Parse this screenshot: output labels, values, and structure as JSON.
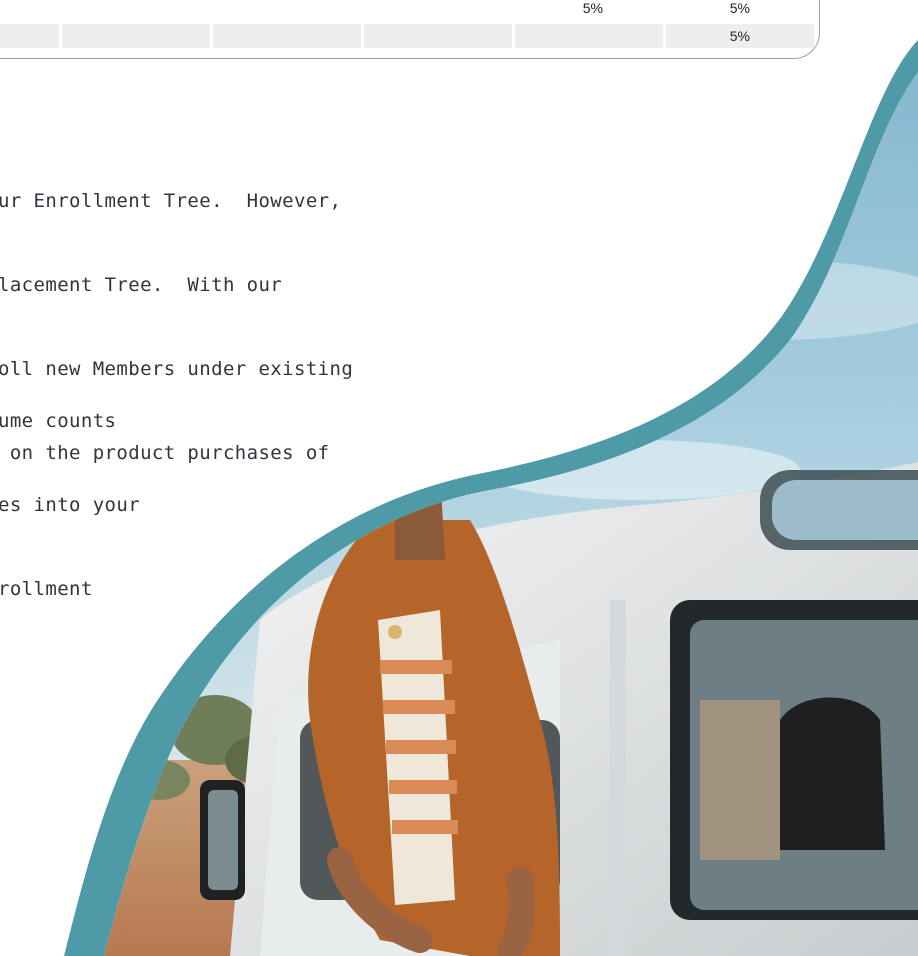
{
  "table": {
    "row1": [
      "",
      "",
      "",
      "",
      "5%",
      "5%"
    ],
    "row2": [
      "",
      "",
      "",
      "",
      "",
      "5%"
    ]
  },
  "paragraph_1": [
    "ur Enrollment Tree.  However,",
    "lacement Tree.  With our",
    "oll new Members under existing",
    " on the product purchases of"
  ],
  "paragraph_2": [
    "ume counts",
    "es into your",
    "rollment"
  ],
  "photo": {
    "description_icon": "woman-in-jeep-photo",
    "frame_color": "#4e9aa6"
  }
}
